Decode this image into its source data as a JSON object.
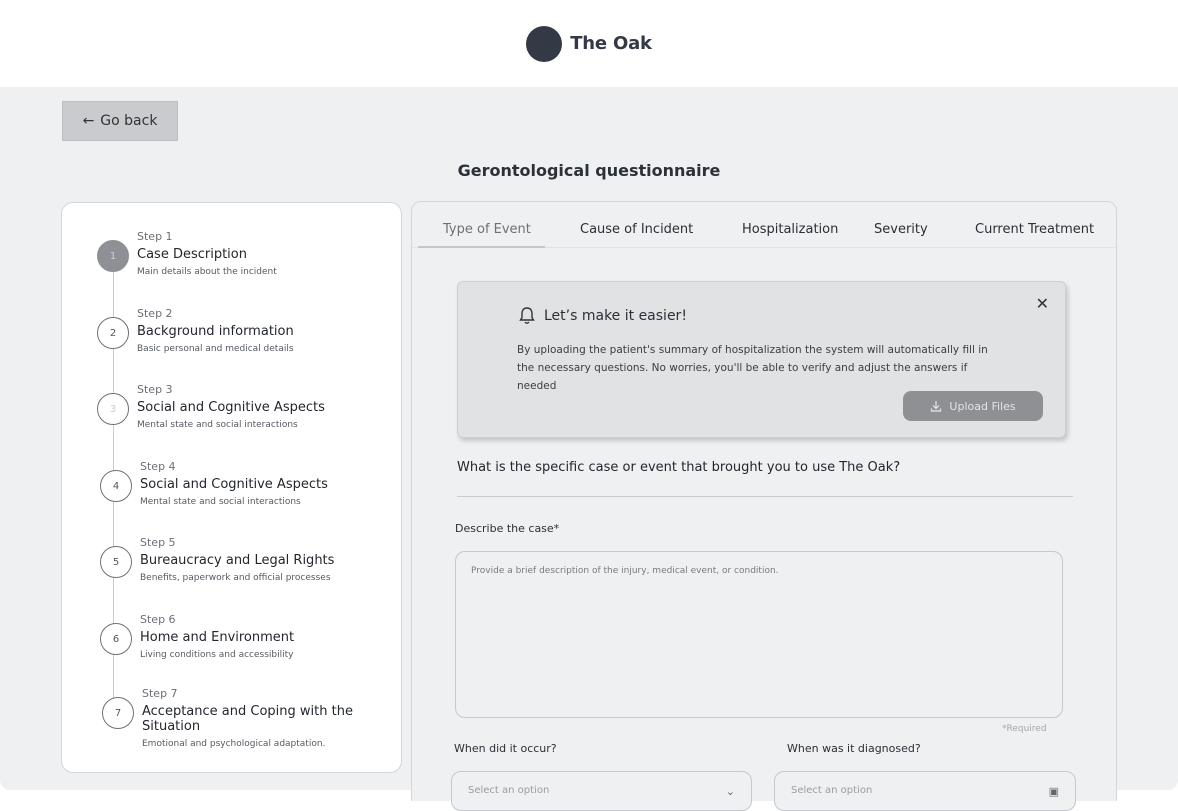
{
  "header": {
    "brand_name": "The Oak"
  },
  "back_button": {
    "label": "Go back"
  },
  "page_title": "Gerontological questionnaire",
  "steps": [
    {
      "number": "1",
      "step_label": "Step 1",
      "title": "Case Description",
      "subtitle": "Main details about the incident",
      "state": "active"
    },
    {
      "number": "2",
      "step_label": "Step 2",
      "title": "Background information",
      "subtitle": "Basic  personal and medical details",
      "state": "default"
    },
    {
      "number": "3",
      "step_label": "Step 3",
      "title": "Social and Cognitive Aspects",
      "subtitle": "Mental state and social interactions",
      "state": "faded"
    },
    {
      "number": "4",
      "step_label": "Step 4",
      "title": "Social and Cognitive Aspects",
      "subtitle": "Mental state and social interactions",
      "state": "default"
    },
    {
      "number": "5",
      "step_label": "Step 5",
      "title": "Bureaucracy and Legal Rights",
      "subtitle": "Benefits, paperwork and official processes",
      "state": "default"
    },
    {
      "number": "6",
      "step_label": "Step 6",
      "title": "Home and Environment",
      "subtitle": "Living conditions and accessibility",
      "state": "default"
    },
    {
      "number": "7",
      "step_label": "Step 7",
      "title": "Acceptance and Coping with the Situation",
      "subtitle": "Emotional and psychological adaptation.",
      "state": "default"
    }
  ],
  "tabs": [
    {
      "label": "Type of Event",
      "active": true
    },
    {
      "label": "Cause of Incident",
      "active": false
    },
    {
      "label": "Hospitalization",
      "active": false
    },
    {
      "label": "Severity",
      "active": false
    },
    {
      "label": "Current Treatment",
      "active": false
    }
  ],
  "callout": {
    "title": "Let’s make it easier!",
    "body": "By uploading the patient's summary of hospitalization the system will automatically fill in the necessary questions. No worries, you'll be able to verify and adjust the answers if needed",
    "upload_label": "Upload Files",
    "close_icon": "close-icon",
    "bell_icon": "bell-icon"
  },
  "form": {
    "question": "What is the specific case or event that brought you to use The Oak?",
    "describe_label": "Describe the case*",
    "describe_placeholder": "Provide a brief description of the injury, medical event, or condition.",
    "required_note": "*Required",
    "occur_label": "When did it occur?",
    "diagnosed_label": "When was it diagnosed?",
    "occur_placeholder": "Select an option",
    "diagnosed_placeholder": "Select an option"
  },
  "colors": {
    "page_bg": "#eef0f2",
    "logo": "#343a45",
    "active_step": "#8e9095",
    "upload_button": "#8e9094",
    "back_button": "#c9cbcf"
  }
}
